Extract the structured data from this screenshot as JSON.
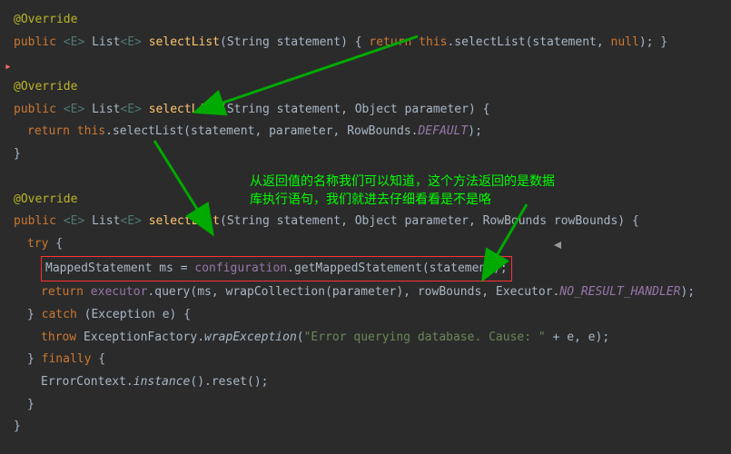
{
  "code": {
    "override": "@Override",
    "line1_p1": "public",
    "line1_p2": "<E>",
    "line1_p3": " List",
    "line1_p4": "<E>",
    "line1_p5": "selectList",
    "line1_p6": "(String statement) {",
    "line1_p7": "return this",
    "line1_p8": ".selectList(statement, ",
    "line1_p9": "null",
    "line1_p10": "); }",
    "line2_p1": "public",
    "line2_p2": "<E>",
    "line2_p3": " List",
    "line2_p4": "<E>",
    "line2_p5": "selectList",
    "line2_p6": "(String statement, Object parameter) {",
    "line3_p1": "return this",
    "line3_p2": ".selectList(statement, parameter, RowBounds.",
    "line3_p3": "DEFAULT",
    "line3_p4": ");",
    "brace_close": "}",
    "line4_p1": "public",
    "line4_p2": "<E>",
    "line4_p3": " List",
    "line4_p4": "<E>",
    "line4_p5": "selectList",
    "line4_p6": "(String statement, Object parameter, RowBounds rowBounds) {",
    "try_open": "try",
    "try_brace": " {",
    "line5_p1": "MappedStatement ms = ",
    "line5_p2": "configuration",
    "line5_p3": ".getMappedStatement(statement);",
    "line6_p1": "return ",
    "line6_p2": "executor",
    "line6_p3": ".query(ms, wrapCollection(parameter), rowBounds, Executor.",
    "line6_p4": "NO_RESULT_HANDLER",
    "line6_p5": ");",
    "catch_p1": "} ",
    "catch_p2": "catch",
    "catch_p3": " (Exception e) {",
    "line7_p1": "throw",
    "line7_p2": " ExceptionFactory.",
    "line7_p3": "wrapException",
    "line7_p4": "(",
    "line7_p5": "\"Error querying database.  Cause: \"",
    "line7_p6": " + e, e);",
    "finally_p1": "} ",
    "finally_p2": "finally",
    "finally_p3": " {",
    "line8_p1": "ErrorContext.",
    "line8_p2": "instance",
    "line8_p3": "().reset();"
  },
  "comment": {
    "line1": "从返回值的名称我们可以知道，这个方法返回的是数据",
    "line2": "库执行语句，我们就进去仔细看看是不是咯"
  }
}
